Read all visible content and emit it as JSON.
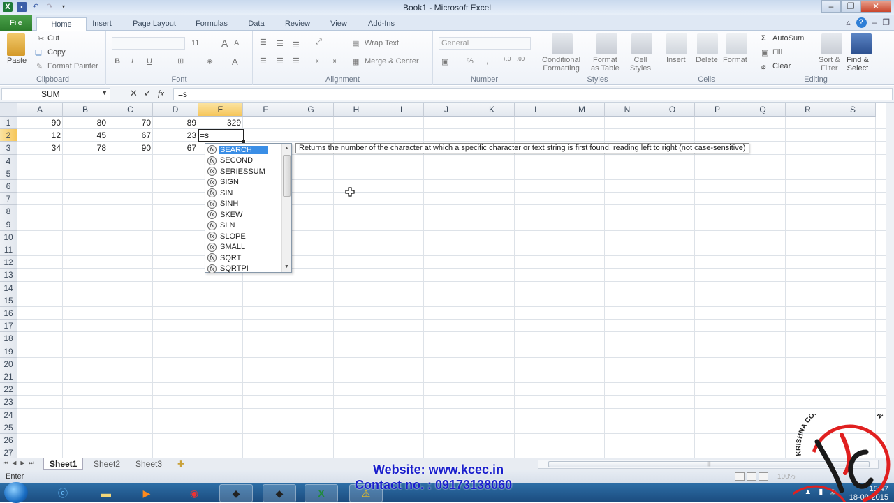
{
  "window": {
    "title": "Book1 - Microsoft Excel",
    "controls": [
      "minimize",
      "restore",
      "close"
    ]
  },
  "ribbon_tabs": [
    {
      "label": "File"
    },
    {
      "label": "Home",
      "active": true
    },
    {
      "label": "Insert"
    },
    {
      "label": "Page Layout"
    },
    {
      "label": "Formulas"
    },
    {
      "label": "Data"
    },
    {
      "label": "Review"
    },
    {
      "label": "View"
    },
    {
      "label": "Add-Ins"
    }
  ],
  "ribbon": {
    "clipboard": {
      "label": "Clipboard",
      "paste": "Paste",
      "cut": "Cut",
      "copy": "Copy",
      "format_painter": "Format Painter"
    },
    "font": {
      "label": "Font",
      "font_name": "",
      "font_size": "11",
      "bold": "B",
      "italic": "I",
      "underline": "U"
    },
    "alignment": {
      "label": "Alignment",
      "wrap_text": "Wrap Text",
      "merge_center": "Merge & Center"
    },
    "number": {
      "label": "Number",
      "format": "General",
      "percent": "%",
      "comma": ","
    },
    "styles": {
      "label": "Styles",
      "conditional_1": "Conditional",
      "conditional_2": "Formatting",
      "format_table_1": "Format",
      "format_table_2": "as Table",
      "cell_styles_1": "Cell",
      "cell_styles_2": "Styles"
    },
    "cells": {
      "label": "Cells",
      "insert": "Insert",
      "delete": "Delete",
      "format": "Format"
    },
    "editing": {
      "label": "Editing",
      "autosum": "AutoSum",
      "fill": "Fill",
      "clear": "Clear",
      "sort_1": "Sort &",
      "sort_2": "Filter",
      "find_1": "Find &",
      "find_2": "Select"
    }
  },
  "formula_bar": {
    "name_box": "SUM",
    "cancel": "✕",
    "enter": "✓",
    "fx": "fx",
    "content": "=s"
  },
  "sheet": {
    "columns": [
      "A",
      "B",
      "C",
      "D",
      "E",
      "F",
      "G",
      "H",
      "I",
      "J",
      "K",
      "L",
      "M",
      "N",
      "O",
      "P",
      "Q",
      "R",
      "S"
    ],
    "selected_column": "E",
    "row_count": 27,
    "selected_row": 2,
    "cells": [
      {
        "ref": "A1",
        "value": "90"
      },
      {
        "ref": "B1",
        "value": "80"
      },
      {
        "ref": "C1",
        "value": "70"
      },
      {
        "ref": "D1",
        "value": "89"
      },
      {
        "ref": "E1",
        "value": "329"
      },
      {
        "ref": "A2",
        "value": "12"
      },
      {
        "ref": "B2",
        "value": "45"
      },
      {
        "ref": "C2",
        "value": "67"
      },
      {
        "ref": "D2",
        "value": "23"
      },
      {
        "ref": "A3",
        "value": "34"
      },
      {
        "ref": "B3",
        "value": "78"
      },
      {
        "ref": "C3",
        "value": "90"
      },
      {
        "ref": "D3",
        "value": "67"
      }
    ],
    "active_cell": {
      "ref": "E2",
      "value": "=s"
    }
  },
  "autocomplete": {
    "items": [
      "SEARCH",
      "SECOND",
      "SERIESSUM",
      "SIGN",
      "SIN",
      "SINH",
      "SKEW",
      "SLN",
      "SLOPE",
      "SMALL",
      "SQRT",
      "SQRTPI"
    ],
    "selected": "SEARCH",
    "tooltip": "Returns the number of the character at which a specific character or text string is first found, reading left to right (not case-sensitive)"
  },
  "sheet_tabs": [
    "Sheet1",
    "Sheet2",
    "Sheet3"
  ],
  "active_sheet": "Sheet1",
  "status_bar": {
    "mode": "Enter",
    "zoom": "100%"
  },
  "watermark": {
    "website": "Website: www.kcec.in",
    "contact": "Contact no. : 09173138060",
    "logo_text": "KRISHNA COMPUTER EDUCATION"
  },
  "taskbar": {
    "time": "15:47",
    "date": "18-09-2015"
  },
  "colors": {
    "file_tab": "#2c7c2c",
    "selection_header": "#f6c65a",
    "autocomplete_highlight": "#3a8ee6",
    "watermark_text": "#1a1fcc",
    "logo_red": "#e02020"
  }
}
